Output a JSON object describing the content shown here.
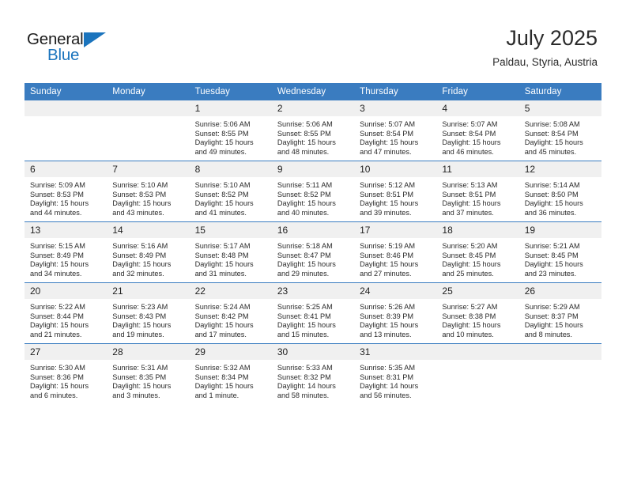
{
  "brand": {
    "name_top": "General",
    "name_bottom": "Blue",
    "triangle_icon": "brand-triangle-icon",
    "colors": {
      "blue": "#1b74bd",
      "dark": "#1d1d1d"
    }
  },
  "header": {
    "title": "July 2025",
    "subtitle": "Paldau, Styria, Austria"
  },
  "theme": {
    "header_blue": "#3a7cc0",
    "daynum_band": "#f0f0f0",
    "text": "#2a2a2a"
  },
  "calendar": {
    "weekday_headers": [
      "Sunday",
      "Monday",
      "Tuesday",
      "Wednesday",
      "Thursday",
      "Friday",
      "Saturday"
    ],
    "labels": {
      "sunrise": "Sunrise:",
      "sunset": "Sunset:",
      "daylight": "Daylight:"
    },
    "weeks": [
      [
        {
          "day": "",
          "blank": true
        },
        {
          "day": "",
          "blank": true
        },
        {
          "day": "1",
          "sunrise": "Sunrise: 5:06 AM",
          "sunset": "Sunset: 8:55 PM",
          "daylight": "Daylight: 15 hours and 49 minutes."
        },
        {
          "day": "2",
          "sunrise": "Sunrise: 5:06 AM",
          "sunset": "Sunset: 8:55 PM",
          "daylight": "Daylight: 15 hours and 48 minutes."
        },
        {
          "day": "3",
          "sunrise": "Sunrise: 5:07 AM",
          "sunset": "Sunset: 8:54 PM",
          "daylight": "Daylight: 15 hours and 47 minutes."
        },
        {
          "day": "4",
          "sunrise": "Sunrise: 5:07 AM",
          "sunset": "Sunset: 8:54 PM",
          "daylight": "Daylight: 15 hours and 46 minutes."
        },
        {
          "day": "5",
          "sunrise": "Sunrise: 5:08 AM",
          "sunset": "Sunset: 8:54 PM",
          "daylight": "Daylight: 15 hours and 45 minutes."
        }
      ],
      [
        {
          "day": "6",
          "sunrise": "Sunrise: 5:09 AM",
          "sunset": "Sunset: 8:53 PM",
          "daylight": "Daylight: 15 hours and 44 minutes."
        },
        {
          "day": "7",
          "sunrise": "Sunrise: 5:10 AM",
          "sunset": "Sunset: 8:53 PM",
          "daylight": "Daylight: 15 hours and 43 minutes."
        },
        {
          "day": "8",
          "sunrise": "Sunrise: 5:10 AM",
          "sunset": "Sunset: 8:52 PM",
          "daylight": "Daylight: 15 hours and 41 minutes."
        },
        {
          "day": "9",
          "sunrise": "Sunrise: 5:11 AM",
          "sunset": "Sunset: 8:52 PM",
          "daylight": "Daylight: 15 hours and 40 minutes."
        },
        {
          "day": "10",
          "sunrise": "Sunrise: 5:12 AM",
          "sunset": "Sunset: 8:51 PM",
          "daylight": "Daylight: 15 hours and 39 minutes."
        },
        {
          "day": "11",
          "sunrise": "Sunrise: 5:13 AM",
          "sunset": "Sunset: 8:51 PM",
          "daylight": "Daylight: 15 hours and 37 minutes."
        },
        {
          "day": "12",
          "sunrise": "Sunrise: 5:14 AM",
          "sunset": "Sunset: 8:50 PM",
          "daylight": "Daylight: 15 hours and 36 minutes."
        }
      ],
      [
        {
          "day": "13",
          "sunrise": "Sunrise: 5:15 AM",
          "sunset": "Sunset: 8:49 PM",
          "daylight": "Daylight: 15 hours and 34 minutes."
        },
        {
          "day": "14",
          "sunrise": "Sunrise: 5:16 AM",
          "sunset": "Sunset: 8:49 PM",
          "daylight": "Daylight: 15 hours and 32 minutes."
        },
        {
          "day": "15",
          "sunrise": "Sunrise: 5:17 AM",
          "sunset": "Sunset: 8:48 PM",
          "daylight": "Daylight: 15 hours and 31 minutes."
        },
        {
          "day": "16",
          "sunrise": "Sunrise: 5:18 AM",
          "sunset": "Sunset: 8:47 PM",
          "daylight": "Daylight: 15 hours and 29 minutes."
        },
        {
          "day": "17",
          "sunrise": "Sunrise: 5:19 AM",
          "sunset": "Sunset: 8:46 PM",
          "daylight": "Daylight: 15 hours and 27 minutes."
        },
        {
          "day": "18",
          "sunrise": "Sunrise: 5:20 AM",
          "sunset": "Sunset: 8:45 PM",
          "daylight": "Daylight: 15 hours and 25 minutes."
        },
        {
          "day": "19",
          "sunrise": "Sunrise: 5:21 AM",
          "sunset": "Sunset: 8:45 PM",
          "daylight": "Daylight: 15 hours and 23 minutes."
        }
      ],
      [
        {
          "day": "20",
          "sunrise": "Sunrise: 5:22 AM",
          "sunset": "Sunset: 8:44 PM",
          "daylight": "Daylight: 15 hours and 21 minutes."
        },
        {
          "day": "21",
          "sunrise": "Sunrise: 5:23 AM",
          "sunset": "Sunset: 8:43 PM",
          "daylight": "Daylight: 15 hours and 19 minutes."
        },
        {
          "day": "22",
          "sunrise": "Sunrise: 5:24 AM",
          "sunset": "Sunset: 8:42 PM",
          "daylight": "Daylight: 15 hours and 17 minutes."
        },
        {
          "day": "23",
          "sunrise": "Sunrise: 5:25 AM",
          "sunset": "Sunset: 8:41 PM",
          "daylight": "Daylight: 15 hours and 15 minutes."
        },
        {
          "day": "24",
          "sunrise": "Sunrise: 5:26 AM",
          "sunset": "Sunset: 8:39 PM",
          "daylight": "Daylight: 15 hours and 13 minutes."
        },
        {
          "day": "25",
          "sunrise": "Sunrise: 5:27 AM",
          "sunset": "Sunset: 8:38 PM",
          "daylight": "Daylight: 15 hours and 10 minutes."
        },
        {
          "day": "26",
          "sunrise": "Sunrise: 5:29 AM",
          "sunset": "Sunset: 8:37 PM",
          "daylight": "Daylight: 15 hours and 8 minutes."
        }
      ],
      [
        {
          "day": "27",
          "sunrise": "Sunrise: 5:30 AM",
          "sunset": "Sunset: 8:36 PM",
          "daylight": "Daylight: 15 hours and 6 minutes."
        },
        {
          "day": "28",
          "sunrise": "Sunrise: 5:31 AM",
          "sunset": "Sunset: 8:35 PM",
          "daylight": "Daylight: 15 hours and 3 minutes."
        },
        {
          "day": "29",
          "sunrise": "Sunrise: 5:32 AM",
          "sunset": "Sunset: 8:34 PM",
          "daylight": "Daylight: 15 hours and 1 minute."
        },
        {
          "day": "30",
          "sunrise": "Sunrise: 5:33 AM",
          "sunset": "Sunset: 8:32 PM",
          "daylight": "Daylight: 14 hours and 58 minutes."
        },
        {
          "day": "31",
          "sunrise": "Sunrise: 5:35 AM",
          "sunset": "Sunset: 8:31 PM",
          "daylight": "Daylight: 14 hours and 56 minutes."
        },
        {
          "day": "",
          "blank": true
        },
        {
          "day": "",
          "blank": true
        }
      ]
    ]
  }
}
